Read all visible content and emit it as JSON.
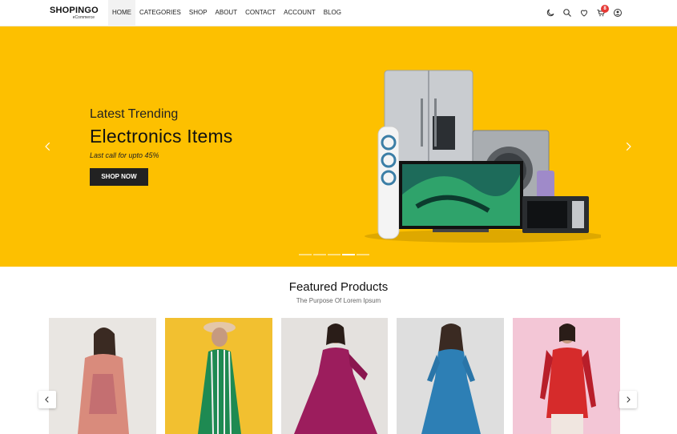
{
  "header": {
    "logo_name": "SHOPINGO",
    "logo_sub": "eCommerce",
    "nav": [
      "HOME",
      "CATEGORIES",
      "SHOP",
      "ABOUT",
      "CONTACT",
      "ACCOUNT",
      "BLOG"
    ],
    "active_nav": "HOME",
    "icons": [
      "moon-icon",
      "search-icon",
      "heart-icon",
      "cart-icon",
      "user-icon"
    ],
    "cart_count": "8"
  },
  "hero": {
    "eyebrow": "Latest Trending",
    "title": "Electronics Items",
    "subtitle": "Last call for upto 45%",
    "button": "SHOP NOW",
    "background": "#fdc000",
    "slides": 5,
    "active_slide": 4
  },
  "featured": {
    "title": "Featured Products",
    "subtitle": "The Purpose Of Lorem Ipsum",
    "products": [
      {
        "name": "floral-kurta-model",
        "bg": "#e9e6e2",
        "dress": "#d98b7c"
      },
      {
        "name": "green-stripe-dress-model",
        "bg": "#f2c030",
        "dress": "#1e8a52"
      },
      {
        "name": "magenta-kurta-model",
        "bg": "#e4e1de",
        "dress": "#9c1d5d"
      },
      {
        "name": "blue-dress-model",
        "bg": "#dedede",
        "dress": "#2d7fb5"
      },
      {
        "name": "red-salwar-model",
        "bg": "#f3c6d6",
        "dress": "#d62b2b"
      }
    ]
  },
  "colors": {
    "accent": "#fdc000",
    "dark": "#222222",
    "badge": "#e53935"
  }
}
